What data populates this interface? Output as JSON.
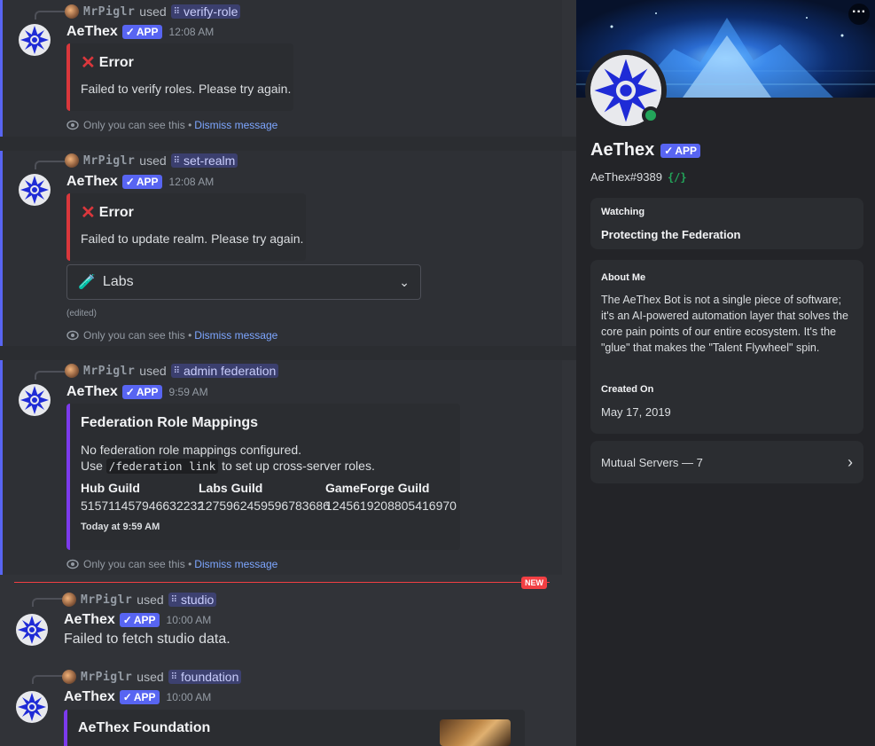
{
  "messages": [
    {
      "reply": {
        "user": "MrPiglr",
        "used": "used",
        "command": "verify-role"
      },
      "author": "AeThex",
      "app_tag": "APP",
      "time": "12:08 AM",
      "embed": {
        "title": "Error",
        "desc": "Failed to verify roles. Please try again."
      },
      "notice": {
        "text": "Only you can see this",
        "sep": "•",
        "dismiss": "Dismiss message"
      }
    },
    {
      "reply": {
        "user": "MrPiglr",
        "used": "used",
        "command": "set-realm"
      },
      "author": "AeThex",
      "app_tag": "APP",
      "time": "12:08 AM",
      "embed": {
        "title": "Error",
        "desc": "Failed to update realm. Please try again."
      },
      "select": {
        "value": "Labs",
        "icon": "🧪"
      },
      "edited": "(edited)",
      "notice": {
        "text": "Only you can see this",
        "sep": "•",
        "dismiss": "Dismiss message"
      }
    },
    {
      "reply": {
        "user": "MrPiglr",
        "used": "used",
        "command": "admin federation"
      },
      "author": "AeThex",
      "app_tag": "APP",
      "time": "9:59 AM",
      "embed": {
        "title": "Federation Role Mappings",
        "desc_line1": "No federation role mappings configured.",
        "desc_use": "Use",
        "desc_code": "/federation link",
        "desc_rest": "to set up cross-server roles.",
        "fields": [
          {
            "name": "Hub Guild",
            "value": "515711457946632232"
          },
          {
            "name": "Labs Guild",
            "value": "1275962459596783686"
          },
          {
            "name": "GameForge Guild",
            "value": "1245619208805416970"
          }
        ],
        "footer": "Today at 9:59 AM"
      },
      "notice": {
        "text": "Only you can see this",
        "sep": "•",
        "dismiss": "Dismiss message"
      }
    },
    {
      "reply": {
        "user": "MrPiglr",
        "used": "used",
        "command": "studio"
      },
      "author": "AeThex",
      "app_tag": "APP",
      "time": "10:00 AM",
      "content": "Failed to fetch studio data."
    },
    {
      "reply": {
        "user": "MrPiglr",
        "used": "used",
        "command": "foundation"
      },
      "author": "AeThex",
      "app_tag": "APP",
      "time": "10:00 AM",
      "embed": {
        "title": "AeThex Foundation"
      }
    }
  ],
  "new_badge": "NEW",
  "profile": {
    "name": "AeThex",
    "app_tag": "APP",
    "handle": "AeThex#9389",
    "handle_icon": "{/}",
    "more": "···",
    "watching_label": "Watching",
    "watching_value": "Protecting the Federation",
    "about_label": "About Me",
    "about_text": "The AeThex Bot is not a single piece of software; it's an AI-powered automation layer that solves the core pain points of our entire ecosystem. It's the \"glue\" that makes the \"Talent Flywheel\" spin.",
    "created_label": "Created On",
    "created_value": "May 17, 2019",
    "mutual": "Mutual Servers — 7"
  },
  "colors": {
    "accent": "#5865f2",
    "error": "#da373c",
    "online": "#23a55a",
    "embed_purple": "#7c3aed"
  }
}
